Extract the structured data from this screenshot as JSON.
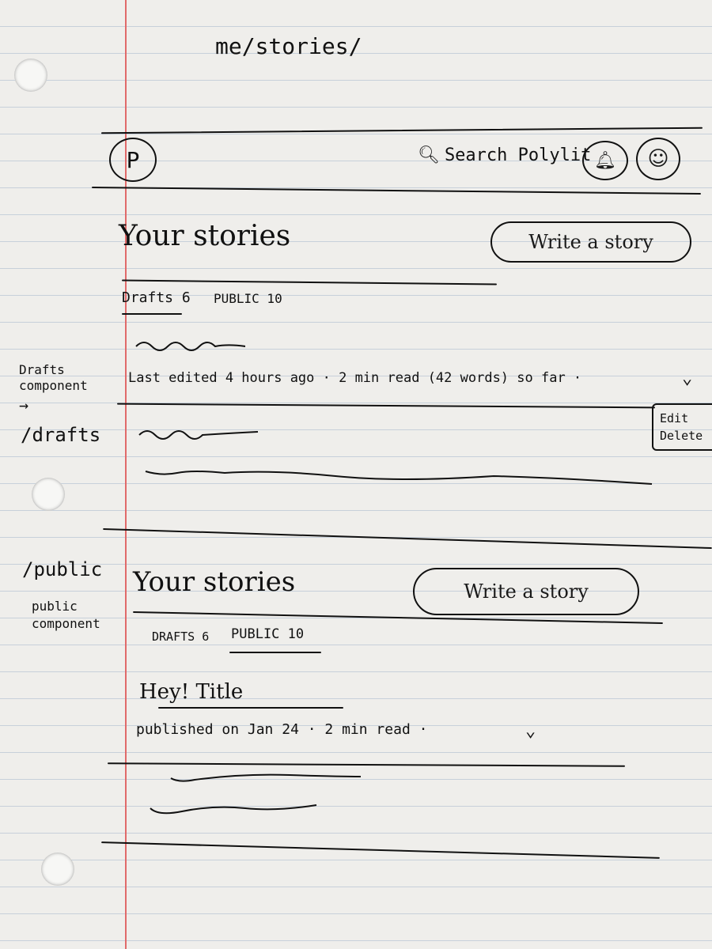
{
  "route": "me/stories/",
  "header": {
    "logo": "P",
    "search_label": "Search Polylit"
  },
  "drafts_view": {
    "title": "Your stories",
    "write_button": "Write a story",
    "tab_drafts": "Drafts 6",
    "tab_public": "PUBLIC 10",
    "draft_meta": "Last edited 4 hours ago · 2 min read (42 words) so far ·",
    "menu_edit": "Edit",
    "menu_delete": "Delete"
  },
  "public_view": {
    "title": "Your stories",
    "write_button": "Write a story",
    "tab_drafts": "DRAFTS 6",
    "tab_public": "PUBLIC 10",
    "story_title": "Hey! Title",
    "story_meta": "published on Jan 24 · 2 min read ·"
  },
  "annotations": {
    "drafts_component": "Drafts component",
    "drafts_route": "/drafts",
    "public_route": "/public",
    "public_component": "public component"
  }
}
